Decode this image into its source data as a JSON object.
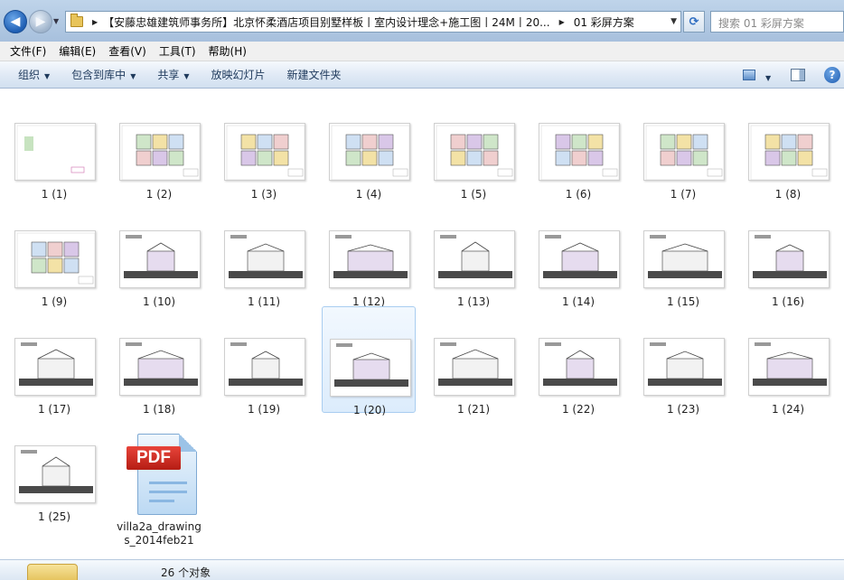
{
  "address_bar": {
    "crumbs": [
      "【安藤忠雄建筑师事务所】北京怀柔酒店项目别墅样板丨室内设计理念+施工图丨24M丨20...",
      "01 彩屏方案"
    ],
    "search_placeholder": "搜索 01 彩屏方案"
  },
  "menu": [
    "文件(F)",
    "编辑(E)",
    "查看(V)",
    "工具(T)",
    "帮助(H)"
  ],
  "toolbar": {
    "organize": "组织",
    "include_in_library": "包含到库中",
    "share": "共享",
    "slideshow": "放映幻灯片",
    "new_folder": "新建文件夹"
  },
  "files": [
    {
      "name": "1 (1)",
      "kind": "sheet"
    },
    {
      "name": "1 (2)",
      "kind": "plan"
    },
    {
      "name": "1 (3)",
      "kind": "plan"
    },
    {
      "name": "1 (4)",
      "kind": "plan"
    },
    {
      "name": "1 (5)",
      "kind": "plan"
    },
    {
      "name": "1 (6)",
      "kind": "plan"
    },
    {
      "name": "1 (7)",
      "kind": "plan"
    },
    {
      "name": "1 (8)",
      "kind": "plan"
    },
    {
      "name": "1 (9)",
      "kind": "plan"
    },
    {
      "name": "1 (10)",
      "kind": "section"
    },
    {
      "name": "1 (11)",
      "kind": "section"
    },
    {
      "name": "1 (12)",
      "kind": "section"
    },
    {
      "name": "1 (13)",
      "kind": "section"
    },
    {
      "name": "1 (14)",
      "kind": "section"
    },
    {
      "name": "1 (15)",
      "kind": "section"
    },
    {
      "name": "1 (16)",
      "kind": "section"
    },
    {
      "name": "1 (17)",
      "kind": "section"
    },
    {
      "name": "1 (18)",
      "kind": "section"
    },
    {
      "name": "1 (19)",
      "kind": "section"
    },
    {
      "name": "1 (20)",
      "kind": "section",
      "selected": true
    },
    {
      "name": "1 (21)",
      "kind": "section"
    },
    {
      "name": "1 (22)",
      "kind": "section"
    },
    {
      "name": "1 (23)",
      "kind": "section"
    },
    {
      "name": "1 (24)",
      "kind": "section"
    },
    {
      "name": "1 (25)",
      "kind": "section"
    },
    {
      "name": "villa2a_drawings_2014feb21",
      "kind": "pdf",
      "badge": "PDF"
    }
  ],
  "status": {
    "item_count": "26 个对象"
  }
}
